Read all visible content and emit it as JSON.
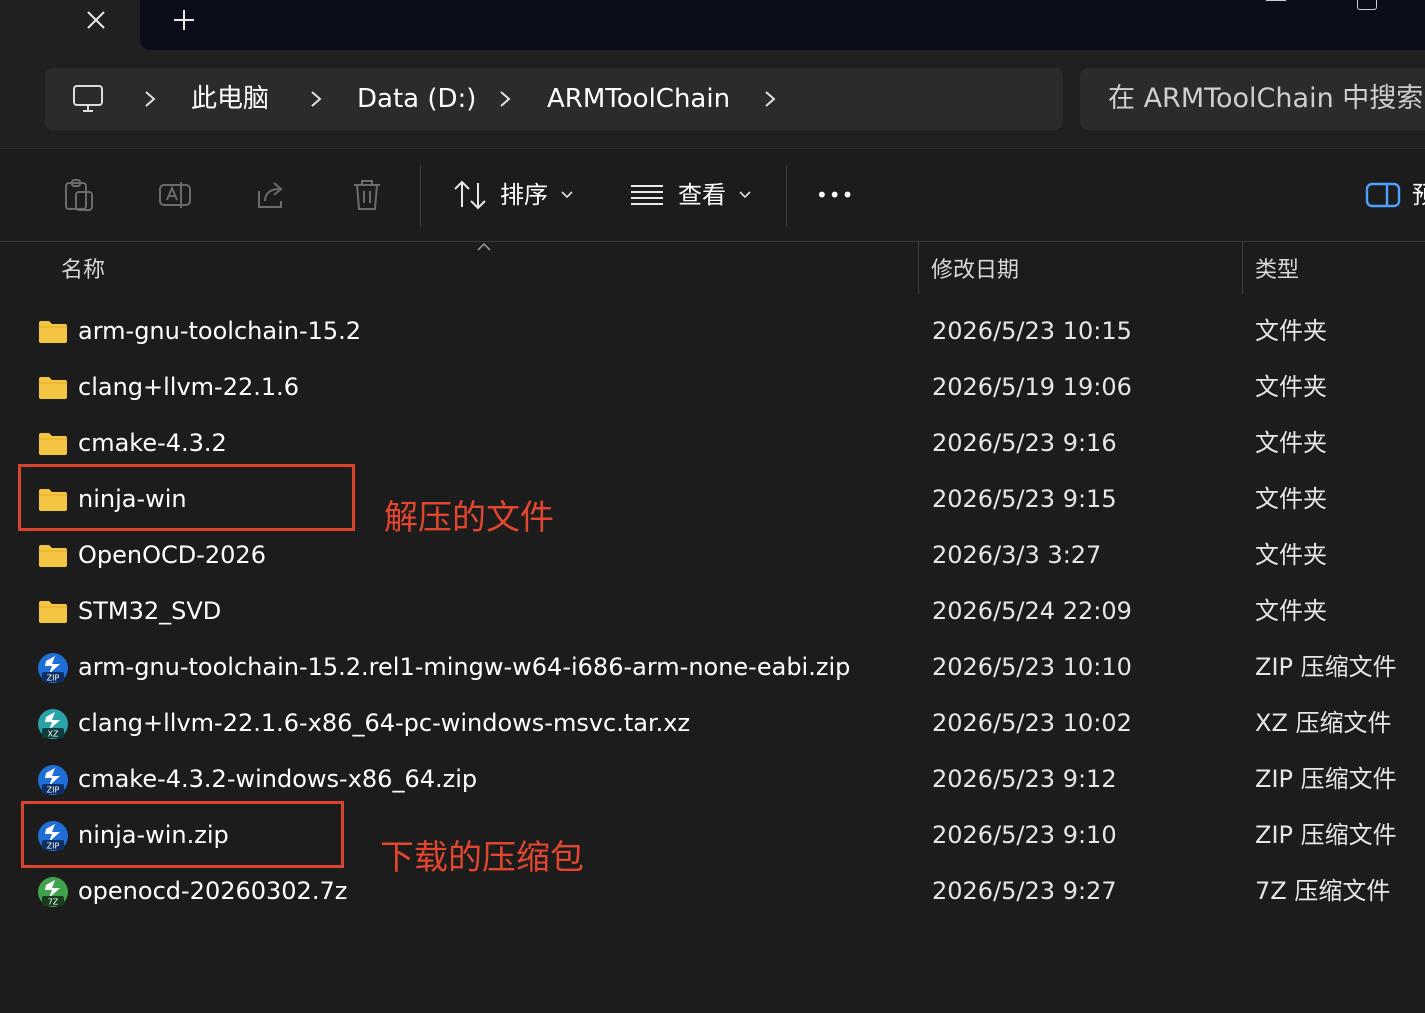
{
  "window": {
    "tab_close_glyph": "✕",
    "tab_new_glyph": "+"
  },
  "address": {
    "crumbs": [
      "此电脑",
      "Data (D:)",
      "ARMToolChain"
    ],
    "search_placeholder": "在 ARMToolChain 中搜索"
  },
  "toolbar": {
    "sort_label": "排序",
    "view_label": "查看",
    "more_label": "•••",
    "preview_label": "预"
  },
  "columns": {
    "name": "名称",
    "date": "修改日期",
    "type": "类型"
  },
  "files": [
    {
      "name": "arm-gnu-toolchain-15.2",
      "date": "2026/5/23 10:15",
      "type": "文件夹",
      "kind": "folder"
    },
    {
      "name": "clang+llvm-22.1.6",
      "date": "2026/5/19 19:06",
      "type": "文件夹",
      "kind": "folder"
    },
    {
      "name": "cmake-4.3.2",
      "date": "2026/5/23 9:16",
      "type": "文件夹",
      "kind": "folder"
    },
    {
      "name": "ninja-win",
      "date": "2026/5/23 9:15",
      "type": "文件夹",
      "kind": "folder"
    },
    {
      "name": "OpenOCD-2026",
      "date": "2026/3/3 3:27",
      "type": "文件夹",
      "kind": "folder"
    },
    {
      "name": "STM32_SVD",
      "date": "2026/5/24 22:09",
      "type": "文件夹",
      "kind": "folder"
    },
    {
      "name": "arm-gnu-toolchain-15.2.rel1-mingw-w64-i686-arm-none-eabi.zip",
      "date": "2026/5/23 10:10",
      "type": "ZIP 压缩文件",
      "kind": "zip",
      "badge": "ZIP"
    },
    {
      "name": "clang+llvm-22.1.6-x86_64-pc-windows-msvc.tar.xz",
      "date": "2026/5/23 10:02",
      "type": "XZ 压缩文件",
      "kind": "xz",
      "badge": "XZ"
    },
    {
      "name": "cmake-4.3.2-windows-x86_64.zip",
      "date": "2026/5/23 9:12",
      "type": "ZIP 压缩文件",
      "kind": "zip",
      "badge": "ZIP"
    },
    {
      "name": "ninja-win.zip",
      "date": "2026/5/23 9:10",
      "type": "ZIP 压缩文件",
      "kind": "zip",
      "badge": "ZIP"
    },
    {
      "name": "openocd-20260302.7z",
      "date": "2026/5/23 9:27",
      "type": "7Z 压缩文件",
      "kind": "7z",
      "badge": "7Z"
    }
  ],
  "annotations": {
    "extracted": "解压的文件",
    "downloaded": "下载的压缩包"
  },
  "colors": {
    "annotation": "#d8442e",
    "folder": "#f4c542",
    "zip_badge": "#1f6fd6",
    "xz_badge": "#2aa3a8",
    "7z_badge": "#3fa34d"
  }
}
